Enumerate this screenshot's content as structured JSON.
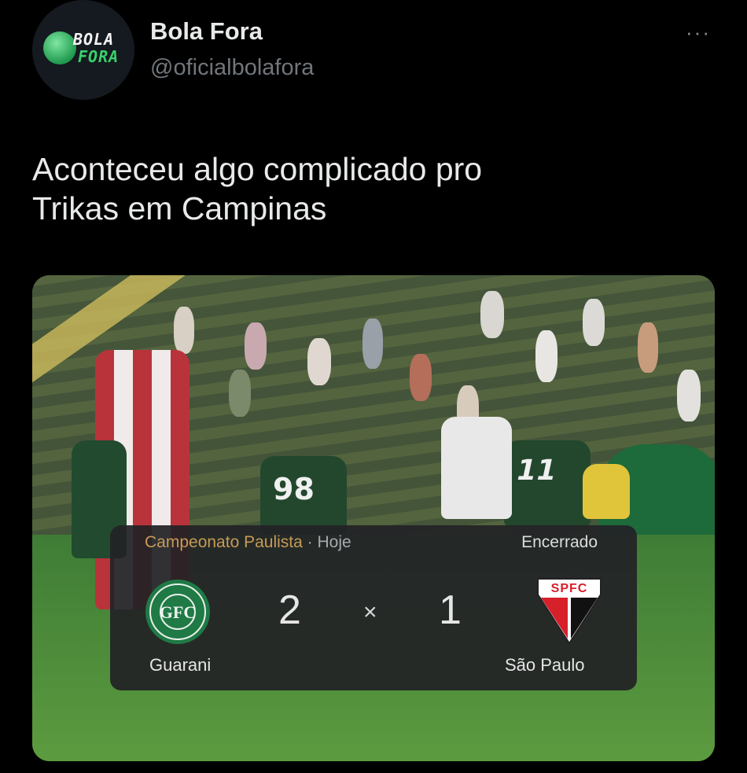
{
  "author": {
    "display_name": "Bola Fora",
    "handle": "@oficialbolafora",
    "avatar_text_1": "BOLA",
    "avatar_text_2": "FORA"
  },
  "menu": {
    "more_label": "···"
  },
  "tweet": {
    "line1": "Aconteceu algo complicado pro",
    "line2": "Trikas em Campinas"
  },
  "photo": {
    "jersey_numbers": [
      "98",
      "11"
    ]
  },
  "match_card": {
    "competition": "Campeonato Paulista",
    "separator": "·",
    "day": "Hoje",
    "status": "Encerrado",
    "home_team": "Guarani",
    "away_team": "São Paulo",
    "home_score": "2",
    "away_score": "1",
    "versus": "×",
    "away_crest_text": "SPFC",
    "colors": {
      "competition": "#c79a55",
      "guarani_green": "#1f7a45",
      "spfc_red": "#d6202a"
    }
  }
}
